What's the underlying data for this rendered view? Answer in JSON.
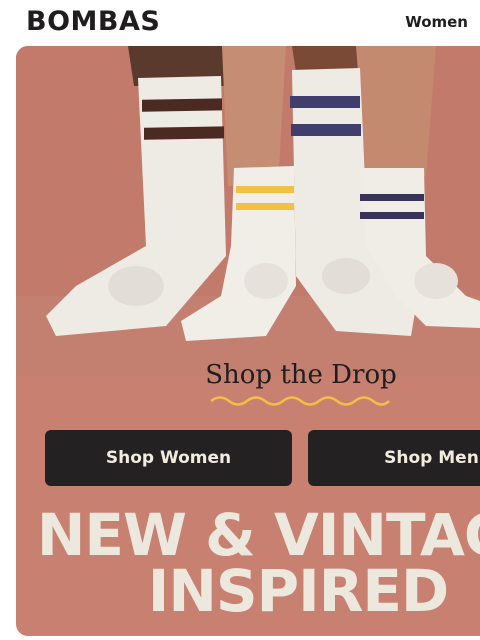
{
  "header": {
    "logo": "BOMBAS",
    "nav_women": "Women"
  },
  "hero": {
    "heading": "Shop the Drop",
    "buttons": {
      "women": "Shop Women",
      "men": "Shop Men"
    },
    "headline_line1": "NEW & VINTAGE",
    "headline_line2": "INSPIRED"
  },
  "colors": {
    "hero_bg": "#c88070",
    "button_bg": "#232122",
    "headline_text": "#ece8dd",
    "squiggle": "#f2c046"
  }
}
